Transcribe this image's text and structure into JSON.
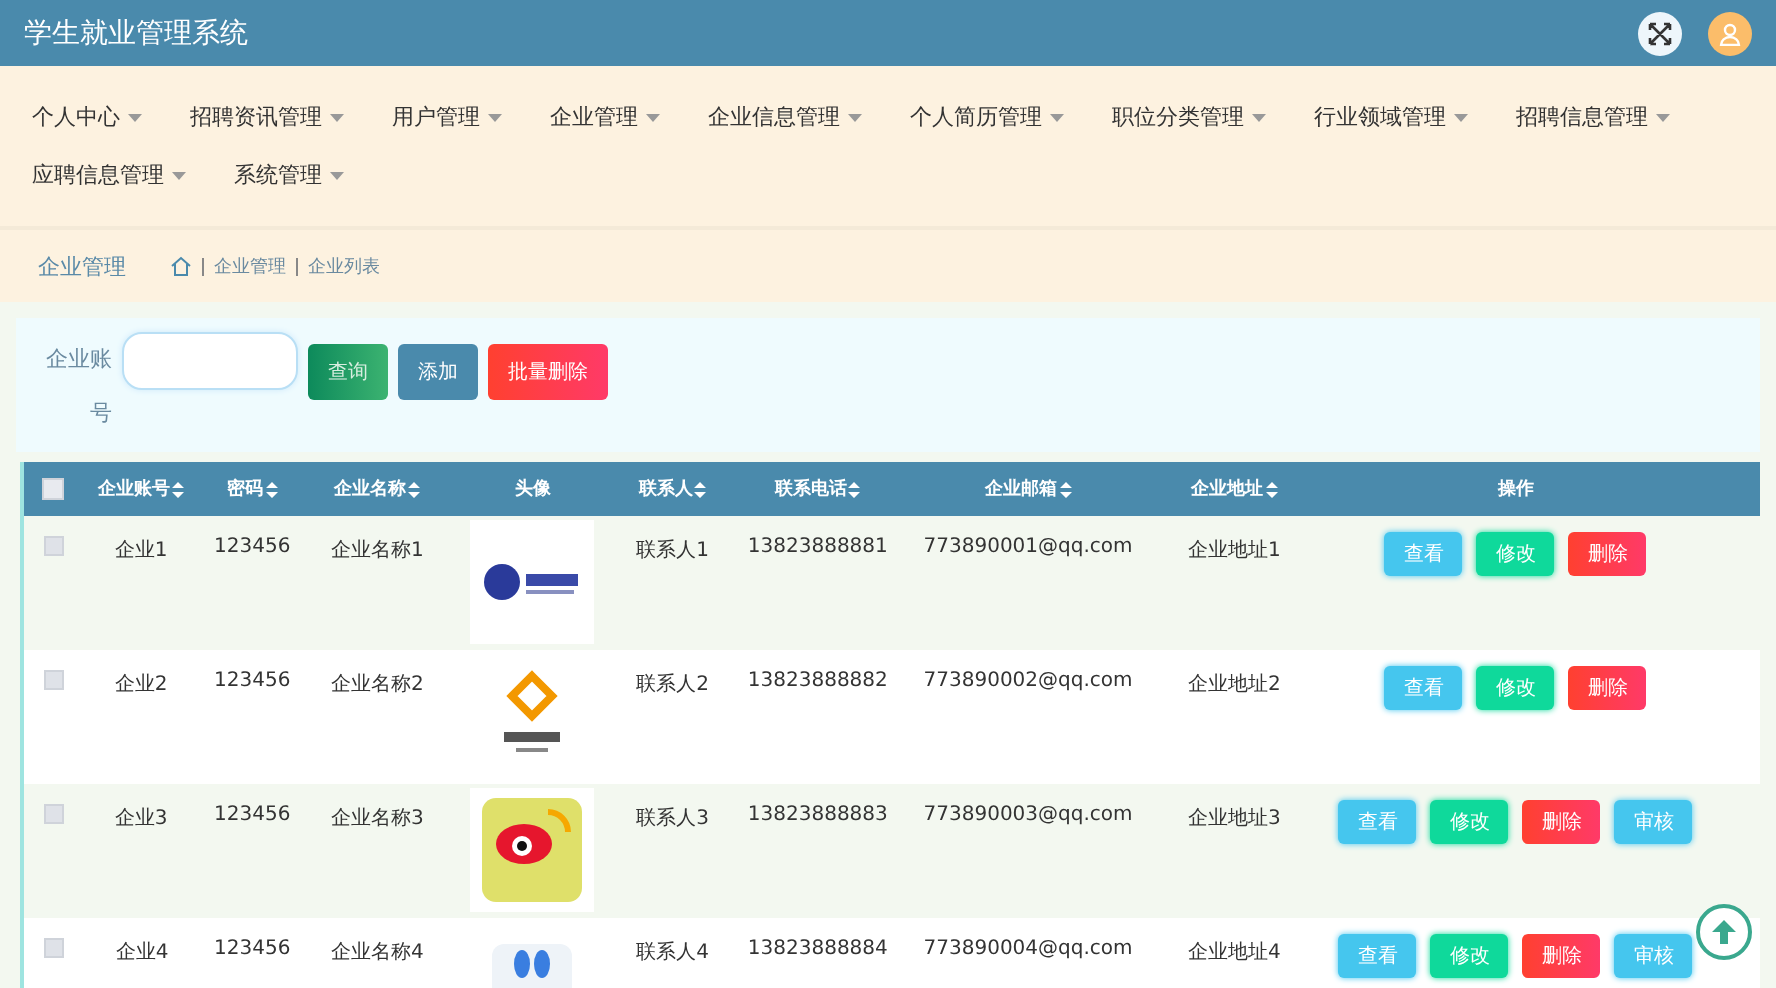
{
  "header": {
    "title": "学生就业管理系统"
  },
  "nav": [
    {
      "label": "个人中心"
    },
    {
      "label": "招聘资讯管理"
    },
    {
      "label": "用户管理"
    },
    {
      "label": "企业管理"
    },
    {
      "label": "企业信息管理"
    },
    {
      "label": "个人简历管理"
    },
    {
      "label": "职位分类管理"
    },
    {
      "label": "行业领域管理"
    },
    {
      "label": "招聘信息管理"
    },
    {
      "label": "应聘信息管理"
    },
    {
      "label": "系统管理"
    }
  ],
  "breadcrumb": {
    "title": "企业管理",
    "path": [
      "企业管理",
      "企业列表"
    ]
  },
  "search": {
    "label": "企业账号",
    "buttons": [
      {
        "label": "查询",
        "kind": "query"
      },
      {
        "label": "添加",
        "kind": "add"
      },
      {
        "label": "批量删除",
        "kind": "delete"
      }
    ]
  },
  "table": {
    "header_checked": false,
    "columns": [
      {
        "label": "企业账号",
        "sortable": true
      },
      {
        "label": "密码",
        "sortable": true
      },
      {
        "label": "企业名称",
        "sortable": true
      },
      {
        "label": "头像",
        "sortable": false
      },
      {
        "label": "联系人",
        "sortable": true
      },
      {
        "label": "联系电话",
        "sortable": true
      },
      {
        "label": "企业邮箱",
        "sortable": true
      },
      {
        "label": "企业地址",
        "sortable": true
      },
      {
        "label": "操作",
        "sortable": false
      }
    ],
    "rows": [
      {
        "checked": false,
        "account": "企业1",
        "password": "123456",
        "name": "企业名称1",
        "contact": "联系人1",
        "phone": "13823888881",
        "email": "773890001@qq.com",
        "address": "企业地址1",
        "actions": [
          {
            "label": "查看",
            "kind": "view"
          },
          {
            "label": "修改",
            "kind": "edit"
          },
          {
            "label": "删除",
            "kind": "delete"
          }
        ]
      },
      {
        "checked": false,
        "account": "企业2",
        "password": "123456",
        "name": "企业名称2",
        "contact": "联系人2",
        "phone": "13823888882",
        "email": "773890002@qq.com",
        "address": "企业地址2",
        "actions": [
          {
            "label": "查看",
            "kind": "view"
          },
          {
            "label": "修改",
            "kind": "edit"
          },
          {
            "label": "删除",
            "kind": "delete"
          }
        ]
      },
      {
        "checked": false,
        "account": "企业3",
        "password": "123456",
        "name": "企业名称3",
        "contact": "联系人3",
        "phone": "13823888883",
        "email": "773890003@qq.com",
        "address": "企业地址3",
        "actions": [
          {
            "label": "查看",
            "kind": "view"
          },
          {
            "label": "修改",
            "kind": "edit"
          },
          {
            "label": "删除",
            "kind": "delete"
          },
          {
            "label": "审核",
            "kind": "review"
          }
        ]
      },
      {
        "checked": false,
        "account": "企业4",
        "password": "123456",
        "name": "企业名称4",
        "contact": "联系人4",
        "phone": "13823888884",
        "email": "773890004@qq.com",
        "address": "企业地址4",
        "actions": [
          {
            "label": "查看",
            "kind": "view"
          },
          {
            "label": "修改",
            "kind": "edit"
          },
          {
            "label": "删除",
            "kind": "delete"
          },
          {
            "label": "审核",
            "kind": "review"
          }
        ]
      }
    ]
  }
}
